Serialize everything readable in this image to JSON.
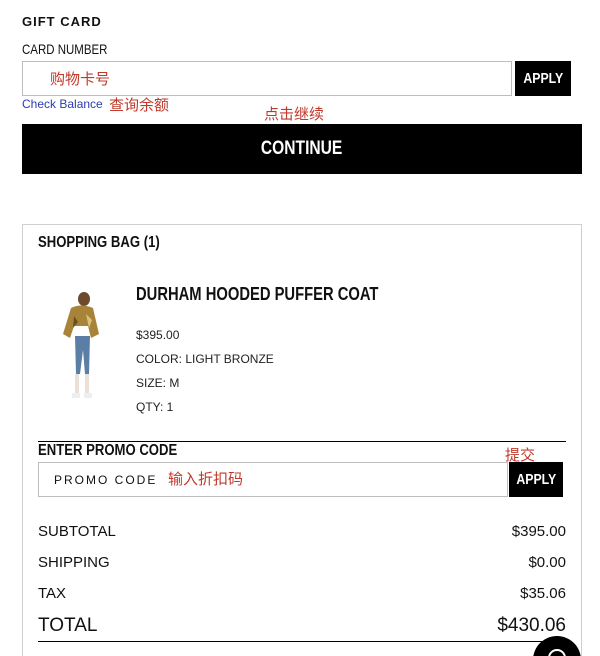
{
  "gift_card": {
    "title": "GIFT CARD",
    "card_number_label": "CARD NUMBER",
    "card_input_annotation": "购物卡号",
    "apply_label": "APPLY",
    "check_balance_label": "Check Balance",
    "check_balance_annotation": "查询余额"
  },
  "continue": {
    "annotation": "点击继续",
    "label": "CONTINUE"
  },
  "shopping_bag": {
    "title": "SHOPPING BAG (1)",
    "product": {
      "name": "DURHAM HOODED PUFFER COAT",
      "price": "$395.00",
      "color": "COLOR: LIGHT BRONZE",
      "size": "SIZE: M",
      "qty": "QTY: 1"
    }
  },
  "promo": {
    "heading": "ENTER PROMO CODE",
    "submit_annotation": "提交",
    "placeholder": "PROMO CODE",
    "input_annotation": "输入折扣码",
    "apply_label": "APPLY"
  },
  "summary": {
    "subtotal_label": "SUBTOTAL",
    "subtotal_value": "$395.00",
    "shipping_label": "SHIPPING",
    "shipping_value": "$0.00",
    "tax_label": "TAX",
    "tax_value": "$35.06",
    "total_label": "TOTAL",
    "total_value": "$430.06"
  },
  "colors": {
    "annotation": "#c0392b",
    "link": "#2b3cb0",
    "button": "#000000"
  },
  "icons": {
    "chat": "chat-icon"
  }
}
